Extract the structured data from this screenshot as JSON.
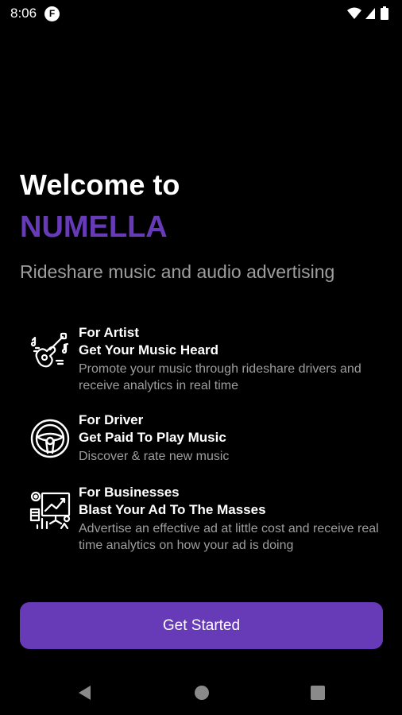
{
  "status_bar": {
    "time": "8:06",
    "app_icon_letter": "F",
    "icons": [
      "wifi-icon",
      "signal-icon",
      "battery-icon"
    ]
  },
  "header": {
    "welcome": "Welcome to",
    "brand": "NUMELLA",
    "tagline": "Rideshare music and audio advertising"
  },
  "features": [
    {
      "icon": "guitar-music-icon",
      "role": "For Artist",
      "headline": "Get Your Music Heard",
      "description": "Promote your music through rideshare drivers and receive analytics in real time"
    },
    {
      "icon": "steering-wheel-icon",
      "role": "For Driver",
      "headline": "Get Paid To Play Music",
      "description": "Discover & rate new music"
    },
    {
      "icon": "presentation-chart-icon",
      "role": "For Businesses",
      "headline": "Blast Your Ad To The Masses",
      "description": "Advertise an effective ad at little cost and receive real time analytics on how your ad is doing"
    }
  ],
  "cta": {
    "label": "Get Started"
  },
  "nav_bar": {
    "icons": [
      "back-icon",
      "home-icon",
      "recents-icon"
    ]
  },
  "colors": {
    "background": "#000000",
    "accent": "#673ab7",
    "text_primary": "#ffffff",
    "text_secondary": "#9e9e9e"
  }
}
